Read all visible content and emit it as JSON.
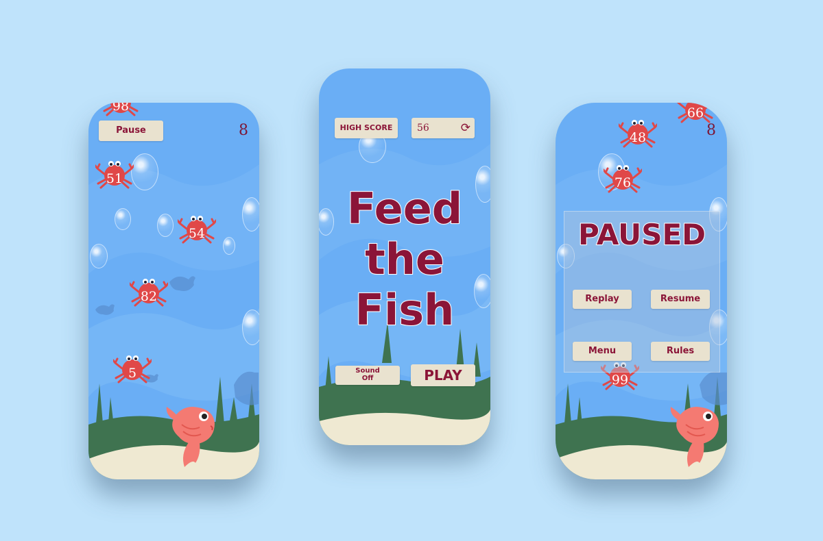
{
  "game_screen": {
    "pause_label": "Pause",
    "score": "8",
    "crab_numbers": [
      "98",
      "51",
      "54",
      "82",
      "5"
    ]
  },
  "menu_screen": {
    "high_score_label": "HIGH SCORE",
    "high_score_value": "56",
    "title_lines": [
      "Feed",
      "the",
      "Fish"
    ],
    "sound_label_line1": "Sound",
    "sound_label_line2": "Off",
    "play_label": "PLAY"
  },
  "paused_screen": {
    "score": "8",
    "crab_numbers": [
      "66",
      "48",
      "76",
      "99"
    ],
    "paused_title": "PAUSED",
    "replay_label": "Replay",
    "resume_label": "Resume",
    "menu_label": "Menu",
    "rules_label": "Rules"
  },
  "colors": {
    "background": "#bfe3fb",
    "water": "#6aaef5",
    "accent_text": "#8b1538",
    "button_bg": "#e9e2cf",
    "crab": "#e04848",
    "seaweed": "#3f7350",
    "sand": "#efe9d2",
    "fish": "#f47a72"
  },
  "icons": {
    "reset_high_score": "refresh-icon",
    "player": "goldfish-icon",
    "enemy": "crab-icon"
  }
}
